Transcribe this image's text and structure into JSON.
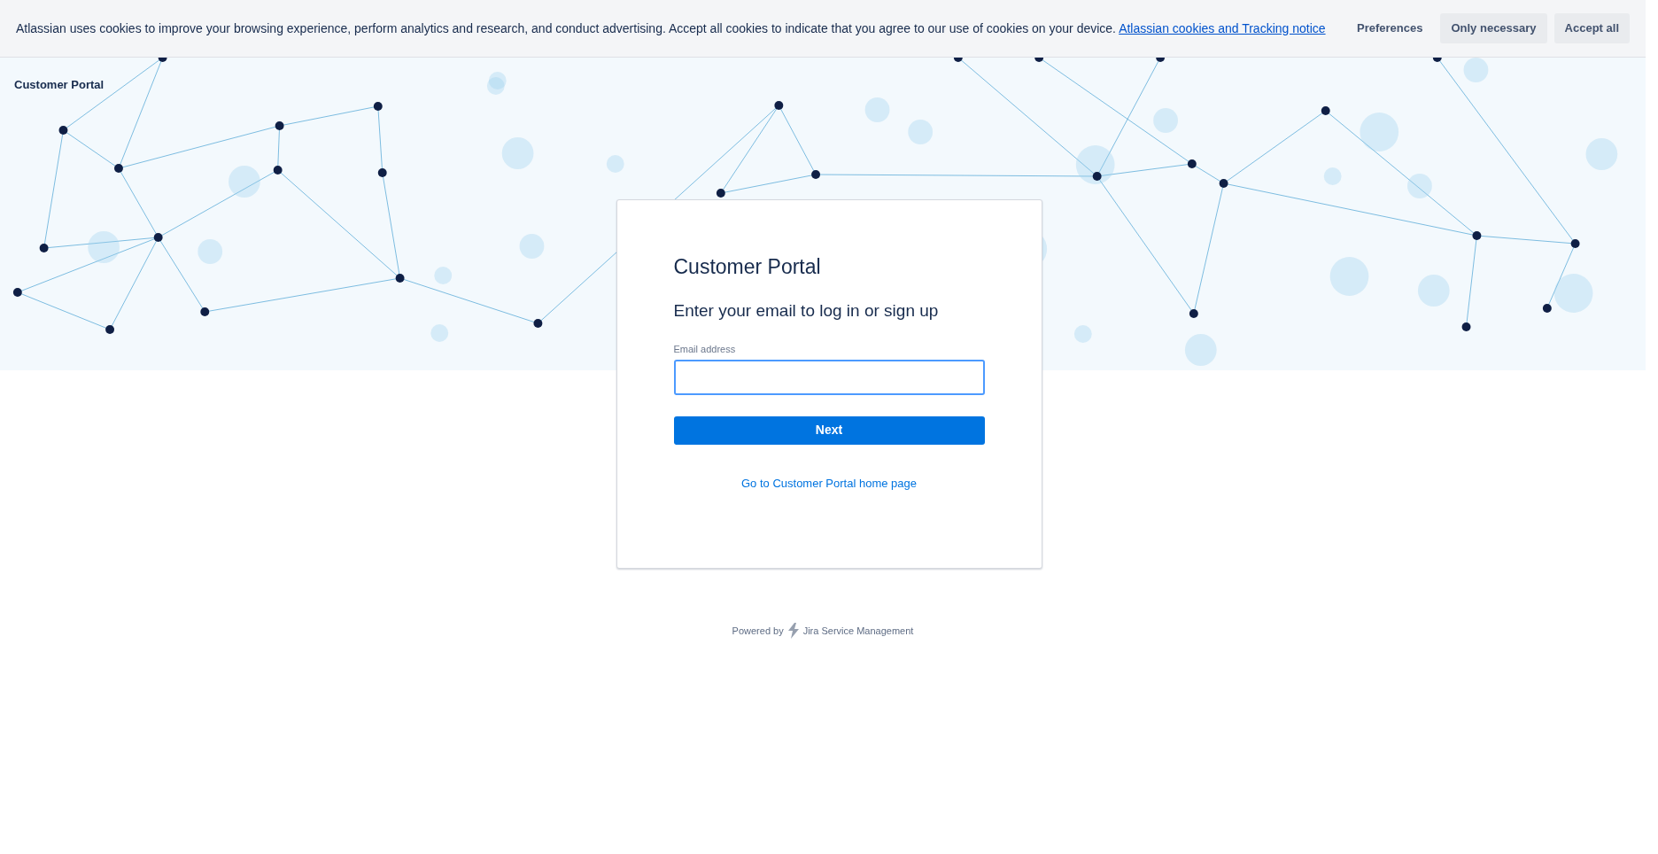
{
  "cookie_banner": {
    "message": "Atlassian uses cookies to improve your browsing experience, perform analytics and research, and conduct advertising. Accept all cookies to indicate that you agree to our use of cookies on your device.",
    "link": "Atlassian cookies and Tracking notice",
    "buttons": [
      {
        "label": "Preferences",
        "kind": "subtle"
      },
      {
        "label": "Only necessary",
        "kind": "default"
      },
      {
        "label": "Accept all",
        "kind": "default"
      }
    ]
  },
  "header": {
    "title": "Customer Portal"
  },
  "login_card": {
    "title": "Customer Portal",
    "subtitle": "Enter your email to log in or sign up",
    "field": {
      "label": "Email address",
      "focused": true
    },
    "submit": "Next",
    "home_link": "Go to Customer Portal home page"
  },
  "footer": {
    "powered_by": "Powered by",
    "product": "Jira Service Management"
  }
}
